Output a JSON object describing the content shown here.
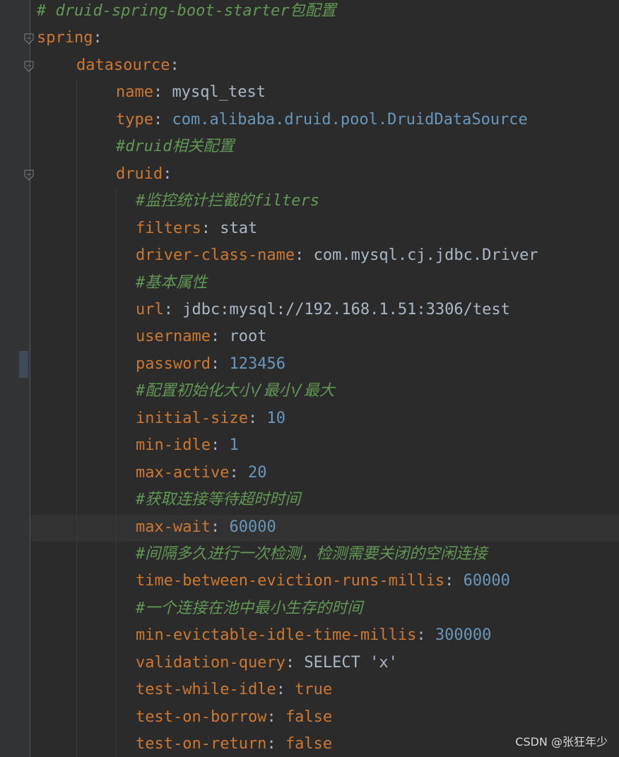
{
  "editor": {
    "lines": [
      {
        "type": "comment",
        "text": "# druid-spring-boot-starter包配置"
      },
      {
        "type": "kv",
        "key": "spring",
        "sep": ":",
        "value": ""
      },
      {
        "type": "kv",
        "key": "datasource",
        "sep": ":",
        "value": ""
      },
      {
        "type": "kv",
        "key": "name",
        "sep": ": ",
        "value": "mysql_test"
      },
      {
        "type": "kv",
        "key": "type",
        "sep": ": ",
        "value": "com.alibaba.druid.pool.DruidDataSource"
      },
      {
        "type": "comment",
        "text": "#druid相关配置"
      },
      {
        "type": "kv",
        "key": "druid",
        "sep": ":",
        "value": ""
      },
      {
        "type": "comment",
        "text": "#监控统计拦截的filters"
      },
      {
        "type": "kv",
        "key": "filters",
        "sep": ": ",
        "value": "stat"
      },
      {
        "type": "kv",
        "key": "driver-class-name",
        "sep": ": ",
        "value": "com.mysql.cj.jdbc.Driver"
      },
      {
        "type": "comment",
        "text": "#基本属性"
      },
      {
        "type": "kv",
        "key": "url",
        "sep": ": ",
        "value": "jdbc:mysql://192.168.1.51:3306/test"
      },
      {
        "type": "kv",
        "key": "username",
        "sep": ": ",
        "value": "root"
      },
      {
        "type": "kv",
        "key": "password",
        "sep": ": ",
        "value": "123456"
      },
      {
        "type": "comment",
        "text": "#配置初始化大小/最小/最大"
      },
      {
        "type": "kv",
        "key": "initial-size",
        "sep": ": ",
        "value": "10"
      },
      {
        "type": "kv",
        "key": "min-idle",
        "sep": ": ",
        "value": "1"
      },
      {
        "type": "kv",
        "key": "max-active",
        "sep": ": ",
        "value": "20"
      },
      {
        "type": "comment",
        "text": "#获取连接等待超时时间"
      },
      {
        "type": "kv",
        "key": "max-wait",
        "sep": ": ",
        "value": "60000"
      },
      {
        "type": "comment",
        "text": "#间隔多久进行一次检测，检测需要关闭的空闲连接"
      },
      {
        "type": "kv",
        "key": "time-between-eviction-runs-millis",
        "sep": ": ",
        "value": "60000"
      },
      {
        "type": "comment",
        "text": "#一个连接在池中最小生存的时间"
      },
      {
        "type": "kv",
        "key": "min-evictable-idle-time-millis",
        "sep": ": ",
        "value": "300000"
      },
      {
        "type": "kv",
        "key": "validation-query",
        "sep": ": ",
        "value": "SELECT 'x'"
      },
      {
        "type": "kv",
        "key": "test-while-idle",
        "sep": ": ",
        "value": "true"
      },
      {
        "type": "kv",
        "key": "test-on-borrow",
        "sep": ": ",
        "value": "false"
      },
      {
        "type": "kv",
        "key": "test-on-return",
        "sep": ": ",
        "value": "false"
      }
    ]
  },
  "watermark": "CSDN @张狂年少",
  "colors": {
    "background": "#2b2b2b",
    "key": "#cc7832",
    "comment": "#629755",
    "number": "#6897bb",
    "text": "#a9b7c6"
  }
}
